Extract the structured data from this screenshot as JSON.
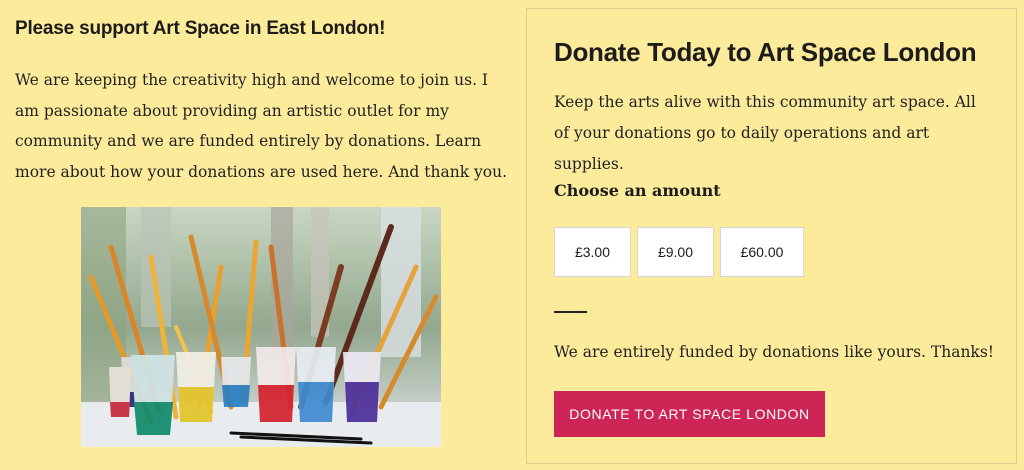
{
  "left": {
    "title": "Please support Art Space in East London!",
    "body": "We are keeping the creativity high and welcome to join us. I am passionate about providing an artistic outlet for my community and we are funded entirely by donations. Learn more about how your donations are used here. And thank you."
  },
  "card": {
    "title": "Donate Today to Art Space London",
    "description": "Keep the arts alive with this community art space. All of your donations go to daily operations and art supplies.",
    "amount_label": "Choose an amount",
    "amounts": [
      "£3.00",
      "£9.00",
      "£60.00"
    ],
    "thanks": "We are entirely funded by donations like yours. Thanks!",
    "donate_label": "DONATE TO ART SPACE LONDON"
  },
  "colors": {
    "background": "#fbeb9a",
    "accent": "#cc2556",
    "card_border": "#d8cc91"
  }
}
